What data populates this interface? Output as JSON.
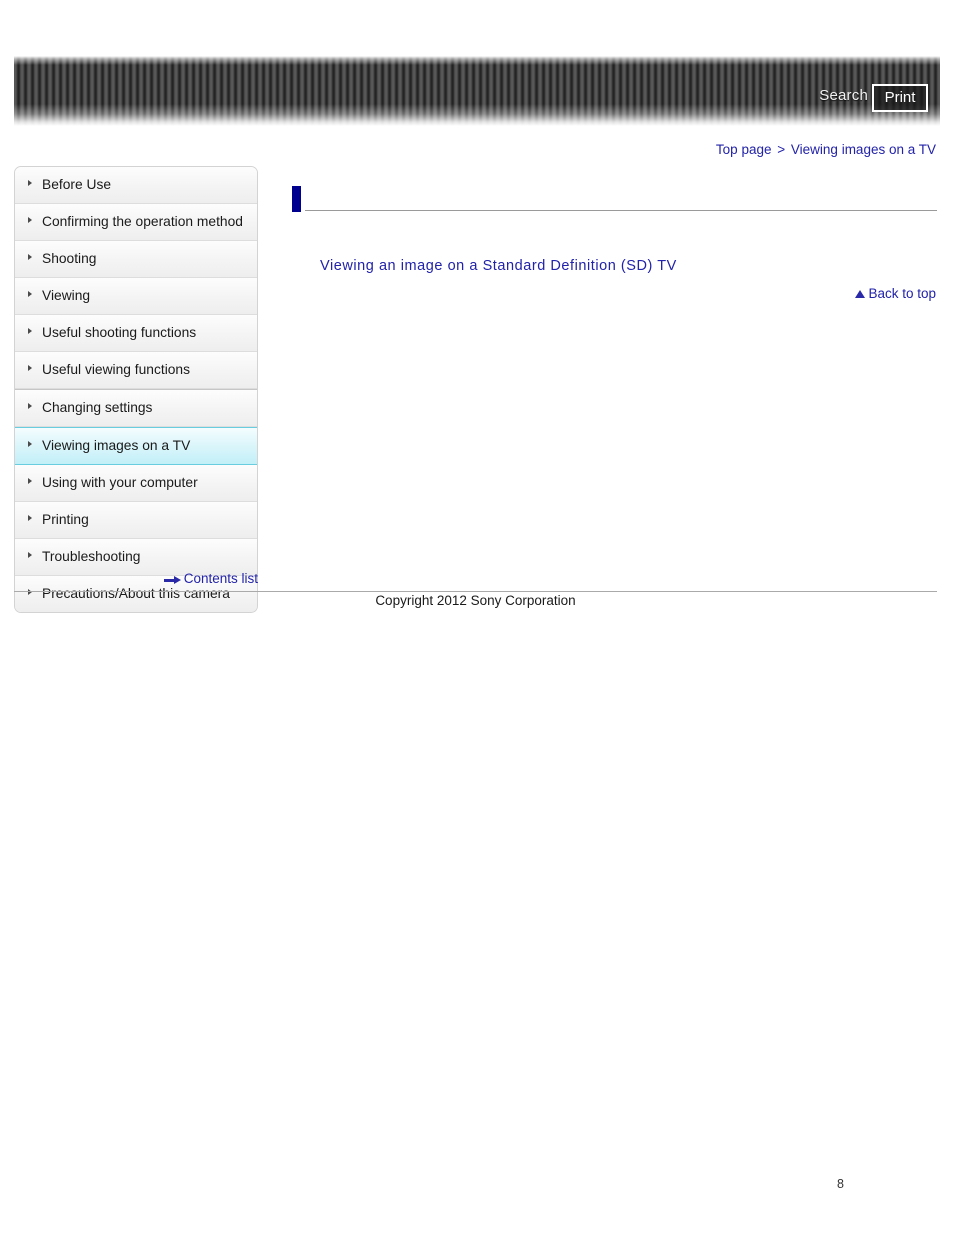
{
  "header": {
    "search_label": "Search",
    "print_label": "Print",
    "stripe_dark": "#262626",
    "stripe_light": "#565656"
  },
  "breadcrumb": {
    "top_page": "Top page",
    "separator": ">",
    "current": "Viewing images on a TV"
  },
  "sidebar": {
    "items": [
      {
        "label": "Before Use",
        "active": false
      },
      {
        "label": "Confirming the operation method",
        "active": false
      },
      {
        "label": "Shooting",
        "active": false
      },
      {
        "label": "Viewing",
        "active": false
      },
      {
        "label": "Useful shooting functions",
        "active": false
      },
      {
        "label": "Useful viewing functions",
        "active": false
      },
      {
        "label": "Changing settings",
        "active": false
      },
      {
        "label": "Viewing images on a TV",
        "active": true
      },
      {
        "label": "Using with your computer",
        "active": false
      },
      {
        "label": "Printing",
        "active": false
      },
      {
        "label": "Troubleshooting",
        "active": false
      },
      {
        "label": "Precautions/About this camera",
        "active": false
      }
    ],
    "contents_list_label": "Contents list",
    "active_accent": "#69cde0"
  },
  "main": {
    "heading": "",
    "heading_accent": "#00008f",
    "links": [
      {
        "label": "Viewing an image on a Standard Definition (SD) TV"
      }
    ],
    "back_to_top_label": "Back to top",
    "link_color": "#2222aa"
  },
  "footer": {
    "copyright": "Copyright 2012 Sony Corporation",
    "page_number": "8"
  }
}
